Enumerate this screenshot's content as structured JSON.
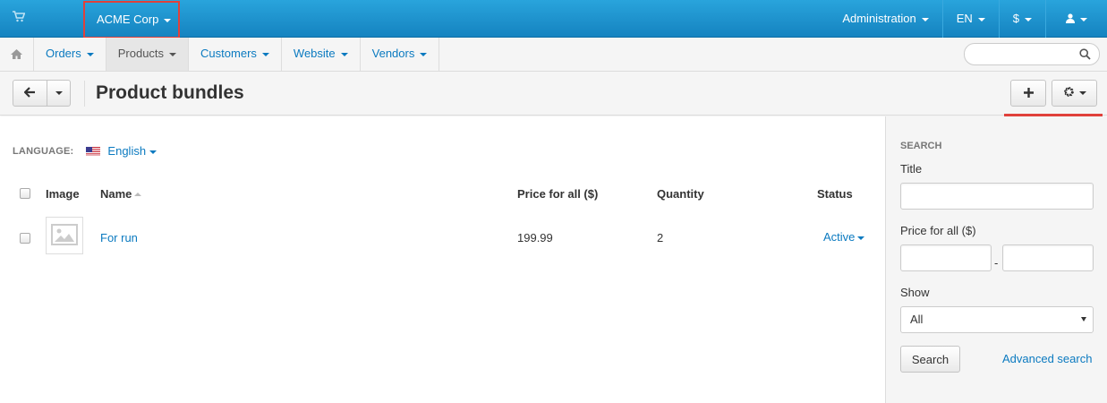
{
  "topbar": {
    "store_name": "ACME Corp",
    "items": [
      "Administration",
      "EN",
      "$"
    ]
  },
  "nav": {
    "items": [
      {
        "label": "Orders"
      },
      {
        "label": "Products"
      },
      {
        "label": "Customers"
      },
      {
        "label": "Website"
      },
      {
        "label": "Vendors"
      }
    ],
    "active": "Products",
    "search_placeholder": ""
  },
  "header": {
    "title": "Product bundles"
  },
  "language": {
    "label": "LANGUAGE:",
    "value": "English"
  },
  "table": {
    "columns": [
      "Image",
      "Name",
      "Price for all ($)",
      "Quantity",
      "Status"
    ],
    "rows": [
      {
        "name": "For run",
        "price": "199.99",
        "quantity": "2",
        "status": "Active"
      }
    ]
  },
  "sidebar": {
    "heading": "SEARCH",
    "title_label": "Title",
    "title_value": "",
    "price_label": "Price for all ($)",
    "price_from": "",
    "price_to": "",
    "price_separator": "-",
    "show_label": "Show",
    "show_value": "All",
    "search_button": "Search",
    "advanced_link": "Advanced search"
  },
  "colors": {
    "topbar": "#1a8fc9",
    "link": "#0b7ac0",
    "highlight": "#e0413b"
  }
}
